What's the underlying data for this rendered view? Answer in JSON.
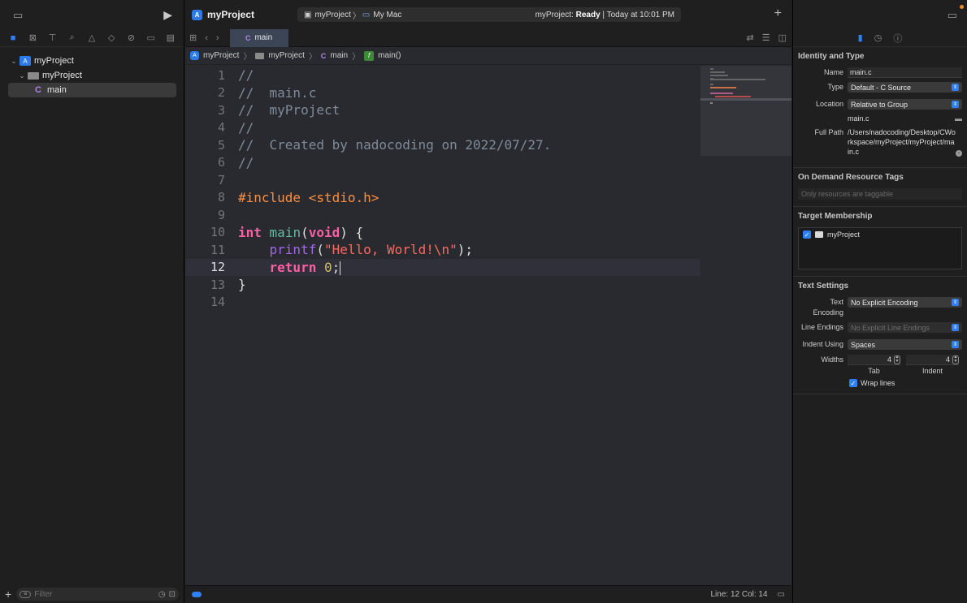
{
  "navigator": {
    "tree": [
      {
        "label": "myProject",
        "kind": "project"
      },
      {
        "label": "myProject",
        "kind": "folder"
      },
      {
        "label": "main",
        "kind": "c-file",
        "selected": true
      }
    ],
    "filter_placeholder": "Filter"
  },
  "editor": {
    "project_title": "myProject",
    "scheme": "myProject",
    "destination": "My Mac",
    "status_prefix": "myProject:",
    "status_state": "Ready",
    "status_suffix": "| Today at 10:01 PM",
    "tab_label": "main",
    "breadcrumb": [
      "myProject",
      "myProject",
      "main",
      "main()"
    ],
    "line_numbers": [
      "1",
      "2",
      "3",
      "4",
      "5",
      "6",
      "7",
      "8",
      "9",
      "10",
      "11",
      "12",
      "13",
      "14"
    ],
    "current_line": 12,
    "status_position": "Line: 12  Col: 14"
  },
  "code": {
    "l1": "//",
    "l2": "//  main.c",
    "l3": "//  myProject",
    "l4": "//",
    "l5": "//  Created by nadocoding on 2022/07/27.",
    "l6": "//",
    "l7": "",
    "l8": "#include <stdio.h>",
    "l9": "",
    "l10_kw": "int",
    "l10_fn": "main",
    "l10_p1": "(",
    "l10_kw2": "void",
    "l10_p2": ") {",
    "l11_indent": "    ",
    "l11_fn": "printf",
    "l11_p1": "(",
    "l11_str": "\"Hello, World!\\n\"",
    "l11_p2": ");",
    "l12_indent": "    ",
    "l12_kw": "return",
    "l12_sp": " ",
    "l12_num": "0",
    "l12_p": ";",
    "l13": "}",
    "l14": ""
  },
  "inspector": {
    "identity_title": "Identity and Type",
    "name_label": "Name",
    "name_value": "main.c",
    "type_label": "Type",
    "type_value": "Default - C Source",
    "location_label": "Location",
    "location_value": "Relative to Group",
    "location_file": "main.c",
    "fullpath_label": "Full Path",
    "fullpath_value": "/Users/nadocoding/Desktop/CWorkspace/myProject/myProject/main.c",
    "odr_title": "On Demand Resource Tags",
    "odr_placeholder": "Only resources are taggable",
    "membership_title": "Target Membership",
    "membership_target": "myProject",
    "text_settings_title": "Text Settings",
    "encoding_label": "Text Encoding",
    "encoding_value": "No Explicit Encoding",
    "line_endings_label": "Line Endings",
    "line_endings_value": "No Explicit Line Endings",
    "indent_using_label": "Indent Using",
    "indent_using_value": "Spaces",
    "widths_label": "Widths",
    "tab_width": "4",
    "indent_width": "4",
    "tab_caption": "Tab",
    "indent_caption": "Indent",
    "wrap_lines_label": "Wrap lines"
  },
  "colors": {
    "accent": "#2f7ff7",
    "editor_bg": "#292a30",
    "keyword": "#fc5fa3",
    "string": "#fc6a5d",
    "number": "#d0bf69",
    "comment": "#7f8c98",
    "preprocessor": "#fd8f3f"
  },
  "icons": [
    "sidebar-toggle-icon",
    "run-icon",
    "folder-icon",
    "search-icon",
    "warning-icon",
    "plus-icon",
    "inspector-toggle-icon",
    "file-icon",
    "history-icon",
    "help-icon"
  ]
}
